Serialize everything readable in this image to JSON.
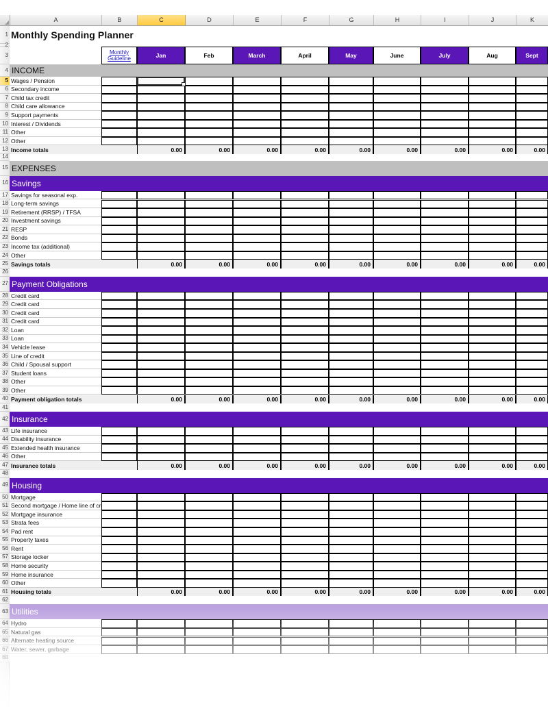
{
  "document": {
    "title": "Monthly Spending Planner"
  },
  "columns": {
    "letters": [
      "A",
      "B",
      "C",
      "D",
      "E",
      "F",
      "G",
      "H",
      "I",
      "J",
      "K"
    ],
    "selected_letter": "C"
  },
  "selection": {
    "cell": "C5",
    "row": 5
  },
  "header_row": {
    "guideline_line1": "Monthly ",
    "guideline_line2": "Guideline",
    "months": [
      "Jan",
      "Feb",
      "March",
      "April",
      "May",
      "June",
      "July",
      "Aug",
      "Sept"
    ]
  },
  "sections": [
    {
      "id": "income",
      "banner": "INCOME",
      "banner_style": "gray",
      "banner_row": 4,
      "rows": [
        {
          "n": 5,
          "label": "Wages / Pension"
        },
        {
          "n": 6,
          "label": "Secondary income"
        },
        {
          "n": 7,
          "label": "Child tax credit"
        },
        {
          "n": 8,
          "label": "Child care allowance"
        },
        {
          "n": 9,
          "label": "Support payments"
        },
        {
          "n": 10,
          "label": "Interest / Dividends"
        },
        {
          "n": 11,
          "label": "Other"
        },
        {
          "n": 12,
          "label": "Other"
        }
      ],
      "total": {
        "n": 13,
        "label": "Income totals",
        "value": "0.00"
      }
    },
    {
      "id": "expenses",
      "banner": "EXPENSES",
      "banner_style": "gray",
      "banner_row": 15,
      "rows": [],
      "total": null
    },
    {
      "id": "savings",
      "banner": "Savings",
      "banner_style": "purple",
      "banner_row": 16,
      "rows": [
        {
          "n": 17,
          "label": "Savings for seasonal exp."
        },
        {
          "n": 18,
          "label": "Long-term savings"
        },
        {
          "n": 19,
          "label": "Retirement (RRSP) / TFSA"
        },
        {
          "n": 20,
          "label": "Investment savings"
        },
        {
          "n": 21,
          "label": "RESP"
        },
        {
          "n": 22,
          "label": "Bonds"
        },
        {
          "n": 23,
          "label": "Income tax (additional)"
        },
        {
          "n": 24,
          "label": "Other"
        }
      ],
      "total": {
        "n": 25,
        "label": "Savings totals",
        "value": "0.00"
      }
    },
    {
      "id": "payment-obligations",
      "banner": "Payment Obligations",
      "banner_style": "purple",
      "banner_row": 27,
      "rows": [
        {
          "n": 28,
          "label": "Credit card"
        },
        {
          "n": 29,
          "label": "Credit card"
        },
        {
          "n": 30,
          "label": "Credit card"
        },
        {
          "n": 31,
          "label": "Credit card"
        },
        {
          "n": 32,
          "label": "Loan"
        },
        {
          "n": 33,
          "label": "Loan"
        },
        {
          "n": 34,
          "label": "Vehicle lease"
        },
        {
          "n": 35,
          "label": "Line of credit"
        },
        {
          "n": 36,
          "label": "Child / Spousal support"
        },
        {
          "n": 37,
          "label": "Student loans"
        },
        {
          "n": 38,
          "label": "Other"
        },
        {
          "n": 39,
          "label": "Other"
        }
      ],
      "total": {
        "n": 40,
        "label": "Payment obligation totals",
        "value": "0.00"
      }
    },
    {
      "id": "insurance",
      "banner": "Insurance",
      "banner_style": "purple",
      "banner_row": 42,
      "rows": [
        {
          "n": 43,
          "label": "Life insurance"
        },
        {
          "n": 44,
          "label": "Disability insurance"
        },
        {
          "n": 45,
          "label": "Extended health insurance"
        },
        {
          "n": 46,
          "label": "Other"
        }
      ],
      "total": {
        "n": 47,
        "label": "Insurance totals",
        "value": "0.00"
      }
    },
    {
      "id": "housing",
      "banner": "Housing",
      "banner_style": "purple",
      "banner_row": 49,
      "rows": [
        {
          "n": 50,
          "label": "Mortgage"
        },
        {
          "n": 51,
          "label": "Second mortgage / Home line of credit"
        },
        {
          "n": 52,
          "label": "Mortgage insurance"
        },
        {
          "n": 53,
          "label": "Strata fees"
        },
        {
          "n": 54,
          "label": "Pad rent"
        },
        {
          "n": 55,
          "label": "Property taxes"
        },
        {
          "n": 56,
          "label": "Rent"
        },
        {
          "n": 57,
          "label": "Storage locker"
        },
        {
          "n": 58,
          "label": "Home security"
        },
        {
          "n": 59,
          "label": "Home insurance"
        },
        {
          "n": 60,
          "label": "Other"
        }
      ],
      "total": {
        "n": 61,
        "label": "Housing totals",
        "value": "0.00"
      }
    },
    {
      "id": "utilities",
      "banner": "Utilities",
      "banner_style": "purple-faded",
      "banner_row": 63,
      "rows": [
        {
          "n": 64,
          "label": "Hydro"
        },
        {
          "n": 65,
          "label": "Natural gas"
        },
        {
          "n": 66,
          "label": "Alternate heating source"
        },
        {
          "n": 67,
          "label": "Water, sewer, garbage"
        }
      ],
      "total": null
    }
  ],
  "colors": {
    "purple": "#5B16B8",
    "purple_faded": "#BCA3E0",
    "banner_gray": "#BFBFBF",
    "total_gray": "#EFEFEF",
    "selection_gold": "#FFCB3D",
    "hyperlink_blue": "#1A14C8"
  }
}
